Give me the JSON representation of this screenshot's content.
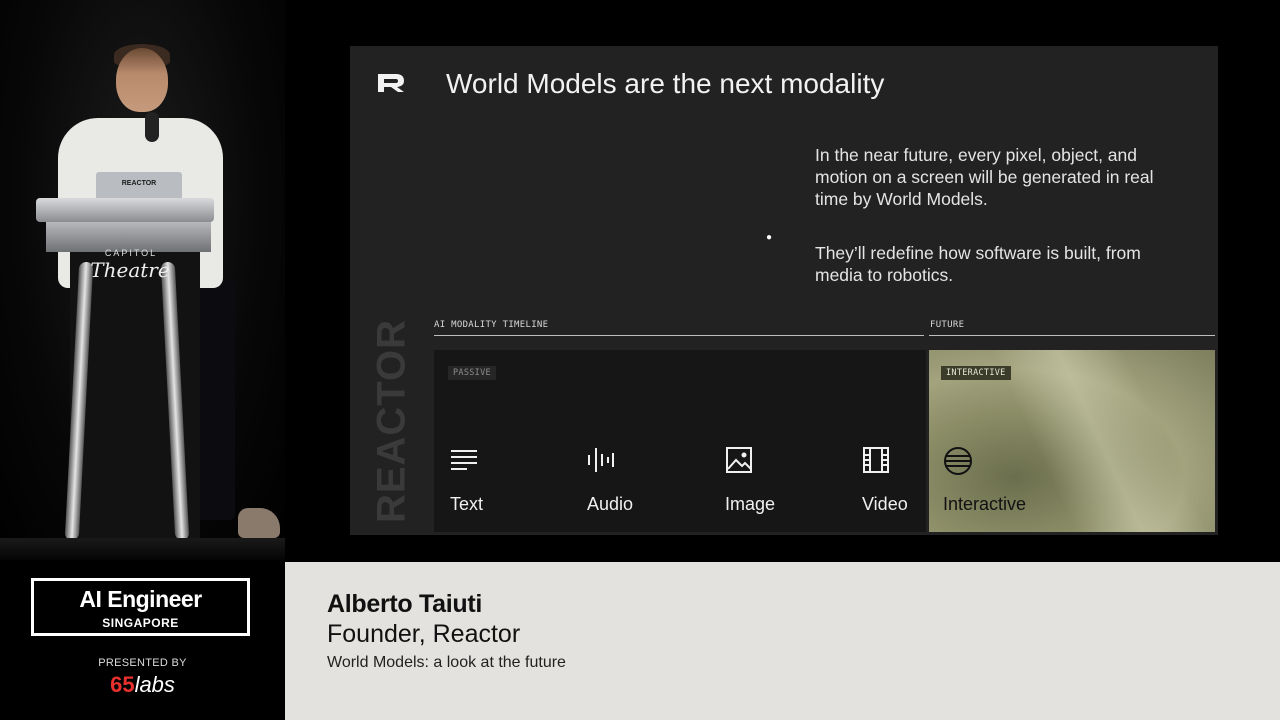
{
  "podium": {
    "laptop_sticker": "REACTOR",
    "brand_top": "CAPITOL",
    "brand": "Theatre"
  },
  "slide": {
    "logo_name": "reactor-logo-mark",
    "title": "World Models are the next modality",
    "paragraphs": [
      "In the near future, every pixel, object, and motion on a screen will be generated in real time by World Models.",
      "They’ll redefine how software is built, from media to robotics."
    ],
    "watermark": "REACTOR",
    "timeline_label": "AI MODALITY TIMELINE",
    "future_label": "FUTURE",
    "passive_tag": "PASSIVE",
    "interactive_tag": "INTERACTIVE",
    "modalities": [
      {
        "label": "Text",
        "icon": "text-lines-icon"
      },
      {
        "label": "Audio",
        "icon": "audio-waveform-icon"
      },
      {
        "label": "Image",
        "icon": "image-icon"
      },
      {
        "label": "Video",
        "icon": "film-strip-icon"
      },
      {
        "label": "Interactive",
        "icon": "globe-icon"
      }
    ]
  },
  "event": {
    "title": "AI Engineer",
    "subtitle": "SINGAPORE",
    "presented_by": "PRESENTED BY",
    "sponsor_number": "65",
    "sponsor_word": "labs"
  },
  "speaker": {
    "name": "Alberto Taiuti",
    "role": "Founder, Reactor",
    "talk": "World Models: a look at the future"
  },
  "colors": {
    "slide_bg": "#222222",
    "passive_bg": "#161616",
    "interactive_bg": "#8a8c66",
    "lower_third_bg": "#e3e2de",
    "sponsor_red": "#e8312f"
  }
}
